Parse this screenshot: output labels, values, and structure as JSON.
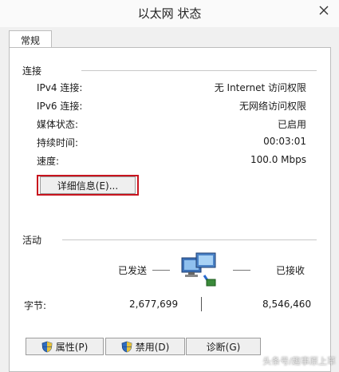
{
  "window": {
    "title": "以太网 状态"
  },
  "tabs": [
    {
      "label": "常规"
    }
  ],
  "connection": {
    "section_title": "连接",
    "rows": [
      {
        "label": "IPv4 连接:",
        "value": "无 Internet 访问权限"
      },
      {
        "label": "IPv6 连接:",
        "value": "无网络访问权限"
      },
      {
        "label": "媒体状态:",
        "value": "已启用"
      },
      {
        "label": "持续时间:",
        "value": "00:03:01"
      },
      {
        "label": "速度:",
        "value": "100.0 Mbps"
      }
    ],
    "details_button": "详细信息(E)..."
  },
  "activity": {
    "section_title": "活动",
    "sent_label": "已发送",
    "received_label": "已接收",
    "bytes_label": "字节:",
    "bytes_sent": "2,677,699",
    "bytes_received": "8,546,460"
  },
  "buttons": {
    "properties": "属性(P)",
    "disable": "禁用(D)",
    "diagnose": "诊断(G)"
  },
  "watermark": "头条号/趣事原上草",
  "colors": {
    "highlight_border": "#c8141e",
    "close_x": "#333333"
  },
  "icons": [
    "close-icon",
    "network-computers-icon",
    "shield-icon"
  ]
}
